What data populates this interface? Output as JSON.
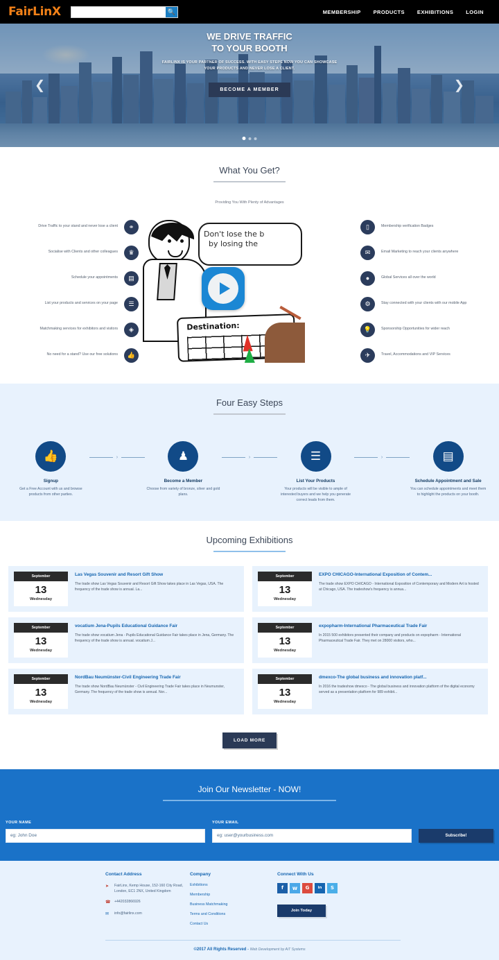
{
  "header": {
    "logo": "FairLinX",
    "search_placeholder": "",
    "search_value": "",
    "search_icon": "search-icon",
    "nav": [
      {
        "label": "MEMBERSHIP"
      },
      {
        "label": "PRODUCTS"
      },
      {
        "label": "EXHIBITIONS"
      },
      {
        "label": "LOGIN"
      }
    ]
  },
  "hero": {
    "title_line1": "WE DRIVE TRAFFIC",
    "title_line2": "TO YOUR BOOTH",
    "subtitle": "FAIRLINX IS YOUR PARTNER OF SUCCESS. WITH EASY STEPS NOW YOU CAN SHOWCASE YOUR PRODUCTS AND NEVER LOSE A CLIENT.",
    "cta": "BECOME A MEMBER",
    "prev_icon": "chevron-left-icon",
    "next_icon": "chevron-right-icon",
    "slides": 3,
    "active_slide": 1
  },
  "what_you_get": {
    "title": "What You Get?",
    "subtitle": "Providing You With Plenty of Advantages",
    "left_features": [
      {
        "text": "Drive Traffic to your stand and never lose a client",
        "icon": "share-nodes-icon",
        "glyph": "⚭"
      },
      {
        "text": "Socialise with Clients and other colleagues",
        "icon": "users-group-icon",
        "glyph": "♛"
      },
      {
        "text": "Schedule your appointments",
        "icon": "calendar-icon",
        "glyph": "▤"
      },
      {
        "text": "List your products and services on your page",
        "icon": "list-icon",
        "glyph": "☰"
      },
      {
        "text": "Matchmaking services for exhibitors and visitors",
        "icon": "handshake-icon",
        "glyph": "◈"
      },
      {
        "text": "No need for a stand? Use our free solutions",
        "icon": "thumbs-up-icon",
        "glyph": "☝"
      }
    ],
    "right_features": [
      {
        "text": "Membership verification Badges",
        "icon": "badge-icon",
        "glyph": "▯"
      },
      {
        "text": "Email Marketing to reach your clients anywhere",
        "icon": "envelope-icon",
        "glyph": "✉"
      },
      {
        "text": "Global Services all over the world",
        "icon": "globe-icon",
        "glyph": "●"
      },
      {
        "text": "Stay connected with your clients with our mobile App",
        "icon": "mobile-app-icon",
        "glyph": "⚙"
      },
      {
        "text": "Sponsorship Opportunities for wider reach",
        "icon": "lightbulb-icon",
        "glyph": "Ὂ1"
      },
      {
        "text": "Travel, Accommodations and VIP Services",
        "icon": "plane-icon",
        "glyph": "✈"
      }
    ],
    "video": {
      "bubble_line1": "Don't lose the b",
      "bubble_line2": "by losing the",
      "card_label": "Destination:",
      "play_icon": "play-button-icon"
    }
  },
  "steps_section": {
    "title": "Four Easy Steps",
    "steps": [
      {
        "name": "Signup",
        "desc": "Get a Free Account with us and browse products from other parties.",
        "icon": "thumbs-up-icon",
        "glyph": "☝"
      },
      {
        "name": "Become a Member",
        "desc": "Choose from variety of bronze, silver and gold plans.",
        "icon": "user-icon",
        "glyph": "♟"
      },
      {
        "name": "List Your Products",
        "desc": "Your products will be visible to ample of interested buyers and we help you generate correct leads from them.",
        "icon": "list-icon",
        "glyph": "☰"
      },
      {
        "name": "Schedule Appointment and Sale",
        "desc": "You can schedule appointments and meet them to highlight the products on your booth.",
        "icon": "calendar-icon",
        "glyph": "▤"
      }
    ],
    "connector_icon": "chevron-right-icon"
  },
  "exhibitions": {
    "title": "Upcoming Exhibitions",
    "load_more": "LOAD MORE",
    "items": [
      {
        "month": "September",
        "day": "13",
        "weekday": "Wednesday",
        "title": "Las Vegas Souvenir and Resort Gift Show",
        "desc": "The trade show Las Vegas Souvenir and Resort Gift Show takes place in Las Vegas, USA. The frequency of the trade show is annual. La..."
      },
      {
        "month": "September",
        "day": "13",
        "weekday": "Wednesday",
        "title": "EXPO CHICAGO-International Exposition of Contem...",
        "desc": "The trade show EXPO CHICAGO - International Exposition of Contemporary and Modern Art is hosted at Chicago, USA. The tradeshow's frequency is annua..."
      },
      {
        "month": "September",
        "day": "13",
        "weekday": "Wednesday",
        "title": "vocatium Jena-Pupils Educational Guidance Fair",
        "desc": "The trade show vocatium Jena - Pupils Educational Guidance Fair takes place in Jena, Germany. The frequency of the trade show is annual. vocatium J..."
      },
      {
        "month": "September",
        "day": "13",
        "weekday": "Wednesday",
        "title": "expopharm-International Pharmaceutical Trade Fair",
        "desc": "In 2015 500 exhibitors presented their company and products on expopharm - International Pharmaceutical Trade Fair. They met on 28000 visitors, who..."
      },
      {
        "month": "September",
        "day": "13",
        "weekday": "Wednesday",
        "title": "NordBau Neumünster-Civil Engineering Trade Fair",
        "desc": "The trade show NordBau Neumünster - Civil Engineering Trade Fair takes place in Neumunster, Germany. The frequency of the trade show is annual. Nor..."
      },
      {
        "month": "September",
        "day": "13",
        "weekday": "Wednesday",
        "title": "dmexco-The global business and innovation platf...",
        "desc": "In 2016 the tradeshow dmexco - The global business and innovation platform of the digital economy served as a presentation platform for 989 exhibit..."
      }
    ]
  },
  "newsletter": {
    "title": "Join Our Newsletter - NOW!",
    "name_label": "YOUR NAME",
    "name_placeholder": "eg: John Doe",
    "email_label": "YOUR EMAIL",
    "email_placeholder": "eg: user@yourbusiness.com",
    "submit": "Subscribe!"
  },
  "footer": {
    "contact": {
      "title": "Contact Address",
      "address": "FairLinx, Kemp House, 152-160 City Road, London, EC1 2NX, United Kingdom",
      "phone": "+442032866926",
      "email": "info@fairlinx.com",
      "address_icon": "location-pin-icon",
      "phone_icon": "phone-icon",
      "email_icon": "envelope-icon"
    },
    "company": {
      "title": "Company",
      "links": [
        {
          "label": "Exhibitions"
        },
        {
          "label": "Membership"
        },
        {
          "label": "Business Matchmaking"
        },
        {
          "label": "Terms and Conditions"
        },
        {
          "label": "Contact Us"
        }
      ]
    },
    "connect": {
      "title": "Connect With Us",
      "socials": [
        {
          "name": "facebook-icon",
          "glyph": "f",
          "color": "#1b5fa8"
        },
        {
          "name": "twitter-icon",
          "glyph": "ᵥ",
          "color": "#4aa8e8"
        },
        {
          "name": "google-plus-icon",
          "glyph": "G",
          "color": "#dc4b3e"
        },
        {
          "name": "linkedin-icon",
          "glyph": "in",
          "color": "#1565b0"
        },
        {
          "name": "skype-icon",
          "glyph": "S",
          "color": "#4aaee8"
        }
      ],
      "join_button": "Join Today"
    },
    "copyright_main": "©2017 All Rights Reserved",
    "copyright_sep": " - ",
    "copyright_credit": "Web Development by AiT Systems"
  },
  "colors": {
    "brand_orange": "#f28118",
    "brand_blue": "#1a72c8",
    "dark_navy": "#2b3a56",
    "deep_blue": "#114a87",
    "light_blue_bg": "#e8f2fd"
  }
}
